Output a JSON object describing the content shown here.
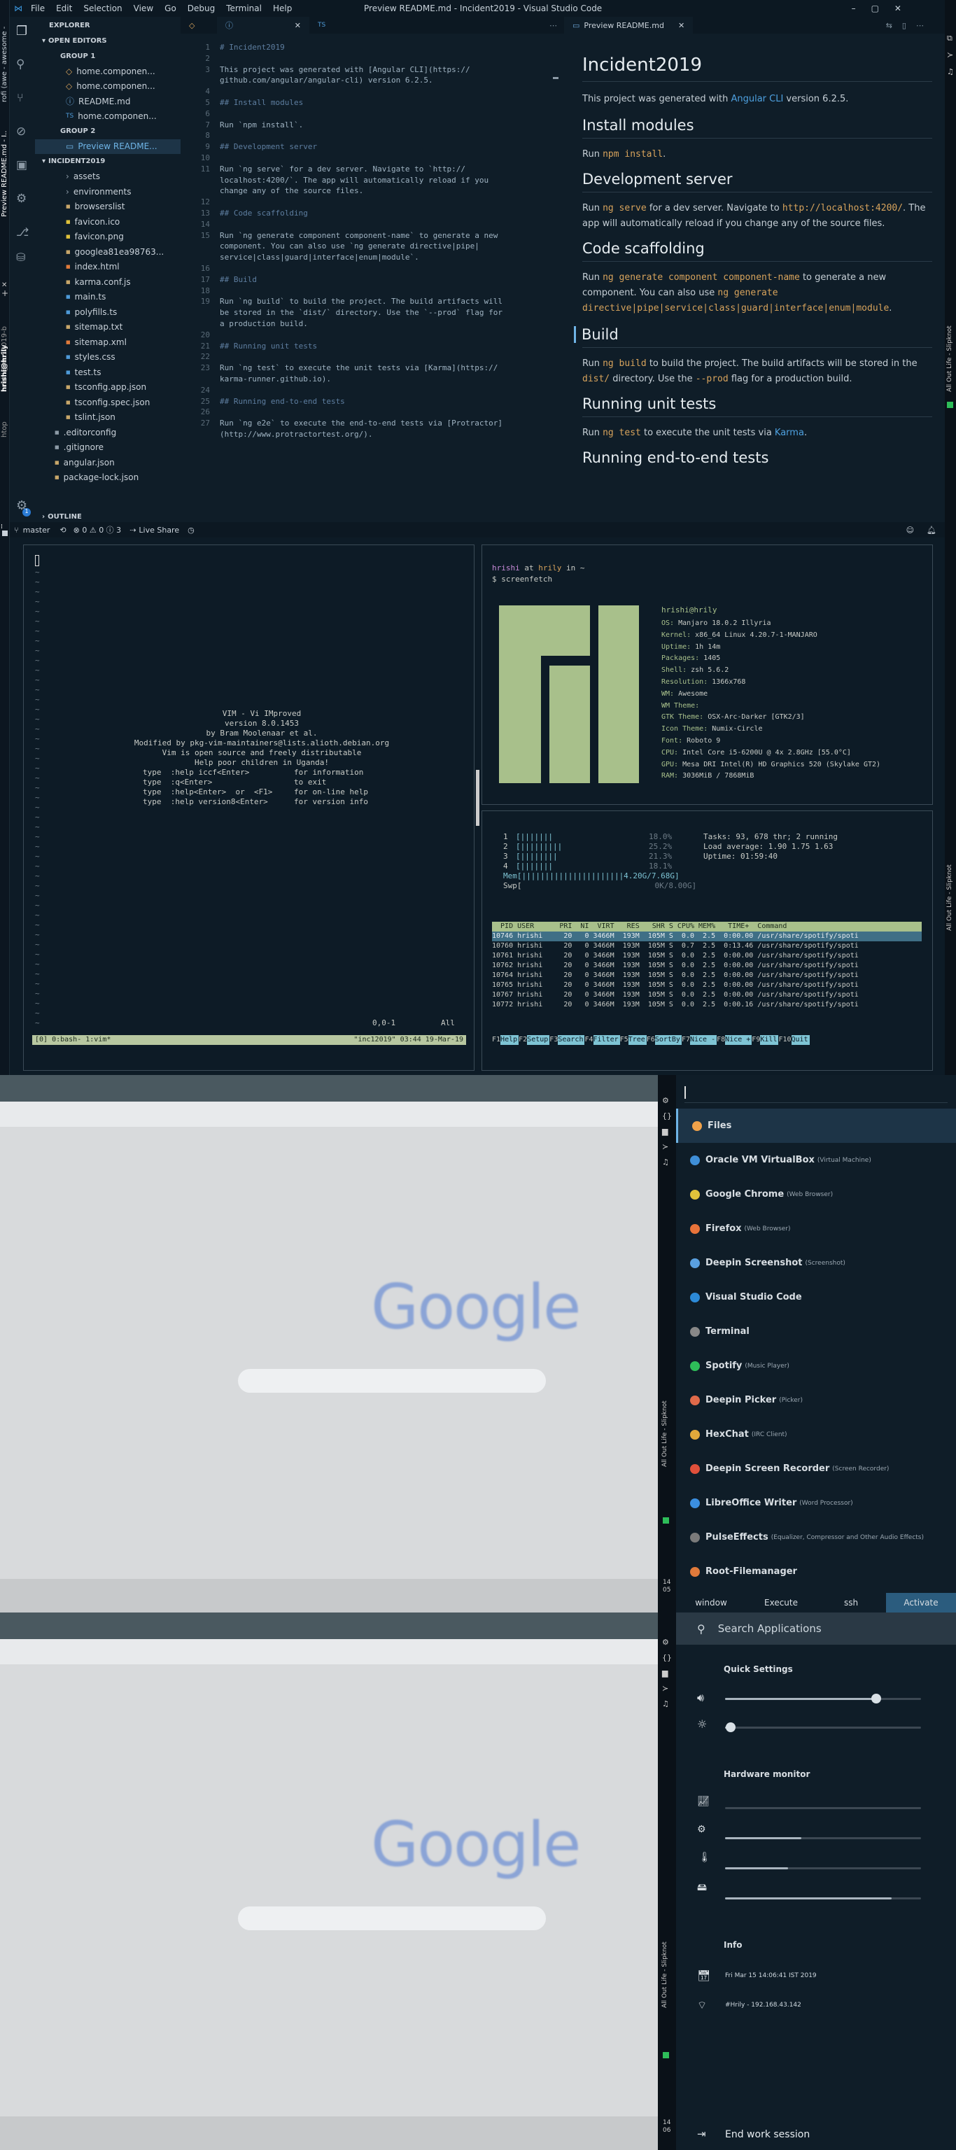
{
  "awesome_bar": {
    "items": [
      "Preview README.md - I..",
      "rofi (awe - awesome -"
    ]
  },
  "vscode": {
    "title": "Preview README.md - Incident2019 - Visual Studio Code",
    "menu": [
      "File",
      "Edit",
      "Selection",
      "View",
      "Go",
      "Debug",
      "Terminal",
      "Help"
    ],
    "explorer_title": "EXPLORER",
    "open_editors": "OPEN EDITORS",
    "group1": "GROUP 1",
    "group1_files": [
      "home.componen...",
      "home.componen...",
      "README.md",
      "home.componen..."
    ],
    "group2": "GROUP 2",
    "group2_files": [
      "Preview README..."
    ],
    "project": "INCIDENT2019",
    "tree": [
      "assets",
      "environments",
      "browserslist",
      "favicon.ico",
      "favicon.png",
      "googlea81ea98763...",
      "index.html",
      "karma.conf.js",
      "main.ts",
      "polyfills.ts",
      "sitemap.txt",
      "sitemap.xml",
      "styles.css",
      "test.ts",
      "tsconfig.app.json",
      "tsconfig.spec.json",
      "tslint.json",
      ".editorconfig",
      ".gitignore",
      "angular.json",
      "package-lock.json"
    ],
    "outline": "OUTLINE",
    "tabs": [
      "",
      "TS"
    ],
    "code": [
      {
        "n": "1",
        "t": "# Incident2019"
      },
      {
        "n": "2",
        "t": ""
      },
      {
        "n": "3",
        "t": "This project was generated with [Angular CLI](https://"
      },
      {
        "n": "",
        "t": "github.com/angular/angular-cli) version 6.2.5."
      },
      {
        "n": "4",
        "t": ""
      },
      {
        "n": "5",
        "t": "## Install modules"
      },
      {
        "n": "6",
        "t": ""
      },
      {
        "n": "7",
        "t": "Run `npm install`."
      },
      {
        "n": "8",
        "t": ""
      },
      {
        "n": "9",
        "t": "## Development server"
      },
      {
        "n": "10",
        "t": ""
      },
      {
        "n": "11",
        "t": "Run `ng serve` for a dev server. Navigate to `http://"
      },
      {
        "n": "",
        "t": "localhost:4200/`. The app will automatically reload if you"
      },
      {
        "n": "",
        "t": "change any of the source files."
      },
      {
        "n": "12",
        "t": ""
      },
      {
        "n": "13",
        "t": "## Code scaffolding"
      },
      {
        "n": "14",
        "t": ""
      },
      {
        "n": "15",
        "t": "Run `ng generate component component-name` to generate a new"
      },
      {
        "n": "",
        "t": "component. You can also use `ng generate directive|pipe|"
      },
      {
        "n": "",
        "t": "service|class|guard|interface|enum|module`."
      },
      {
        "n": "16",
        "t": ""
      },
      {
        "n": "17",
        "t": "## Build"
      },
      {
        "n": "18",
        "t": ""
      },
      {
        "n": "19",
        "t": "Run `ng build` to build the project. The build artifacts will"
      },
      {
        "n": "",
        "t": "be stored in the `dist/` directory. Use the `--prod` flag for"
      },
      {
        "n": "",
        "t": "a production build."
      },
      {
        "n": "20",
        "t": ""
      },
      {
        "n": "21",
        "t": "## Running unit tests"
      },
      {
        "n": "22",
        "t": ""
      },
      {
        "n": "23",
        "t": "Run `ng test` to execute the unit tests via [Karma](https://"
      },
      {
        "n": "",
        "t": "karma-runner.github.io)."
      },
      {
        "n": "24",
        "t": ""
      },
      {
        "n": "25",
        "t": "## Running end-to-end tests"
      },
      {
        "n": "26",
        "t": ""
      },
      {
        "n": "27",
        "t": "Run `ng e2e` to execute the end-to-end tests via [Protractor]"
      },
      {
        "n": "",
        "t": "(http://www.protractortest.org/)."
      }
    ],
    "preview_tab": "Preview README.md",
    "preview": {
      "h1": "Incident2019",
      "p1a": "This project was generated with ",
      "p1link": "Angular CLI",
      "p1b": " version 6.2.5.",
      "h_install": "Install modules",
      "p_install_a": "Run ",
      "p_install_code": "npm install",
      "p_install_b": ".",
      "h_dev": "Development server",
      "p_dev_a": "Run ",
      "p_dev_code": "ng serve",
      "p_dev_b": " for a dev server. Navigate to ",
      "p_dev_code2": "http://localhost:4200/",
      "p_dev_c": ". The app will automatically reload if you change any of the source files.",
      "h_scaf": "Code scaffolding",
      "p_scaf_a": "Run ",
      "p_scaf_code": "ng generate component component-name",
      "p_scaf_b": " to generate a new component. You can also use ",
      "p_scaf_code2": "ng generate directive|pipe|service|class|guard|interface|enum|module",
      "p_scaf_c": ".",
      "h_build": "Build",
      "p_build_a": "Run ",
      "p_build_code": "ng build",
      "p_build_b": " to build the project. The build artifacts will be stored in the ",
      "p_build_code2": "dist/",
      "p_build_c": " directory. Use the ",
      "p_build_code3": "--prod",
      "p_build_d": " flag for a production build.",
      "h_unit": "Running unit tests",
      "p_unit_a": "Run ",
      "p_unit_code": "ng test",
      "p_unit_b": " to execute the unit tests via ",
      "p_unit_link": "Karma",
      "p_unit_c": ".",
      "h_e2e": "Running end-to-end tests"
    },
    "status": {
      "branch": "master",
      "counts": "⊗ 0 ⚠ 0 ⓘ 3",
      "live": "Live Share"
    }
  },
  "vim": {
    "lines": [
      "VIM - Vi IMproved",
      "",
      "version 8.0.1453",
      "by Bram Moolenaar et al.",
      "Modified by pkg-vim-maintainers@lists.alioth.debian.org",
      "Vim is open source and freely distributable",
      "",
      "Help poor children in Uganda!"
    ],
    "help": [
      {
        "a": "type  :help iccf<Enter>",
        "b": "for information"
      },
      {
        "a": "type  :q<Enter>",
        "b": "to exit"
      },
      {
        "a": "type  :help<Enter>  or  <F1>",
        "b": "for on-line help"
      },
      {
        "a": "type  :help version8<Enter>",
        "b": "for version info"
      }
    ],
    "pos": "0,0-1",
    "all": "All",
    "status_left": "[0] 0:bash- 1:vim*",
    "status_right": "\"inc12019\" 03:44 19-Mar-19"
  },
  "screenfetch": {
    "prompt_user": "hrishi",
    "prompt_at": " at ",
    "prompt_host": "hrily",
    "prompt_in": " in ~",
    "cmd": "$ screenfetch",
    "header": "hrishi@hrily",
    "info": [
      {
        "k": "OS:",
        "v": "Manjaro 18.0.2 Illyria"
      },
      {
        "k": "Kernel:",
        "v": "x86_64 Linux 4.20.7-1-MANJARO"
      },
      {
        "k": "Uptime:",
        "v": "1h 14m"
      },
      {
        "k": "Packages:",
        "v": "1405"
      },
      {
        "k": "Shell:",
        "v": "zsh 5.6.2"
      },
      {
        "k": "Resolution:",
        "v": "1366x768"
      },
      {
        "k": "WM:",
        "v": "Awesome"
      },
      {
        "k": "WM Theme:",
        "v": ""
      },
      {
        "k": "GTK Theme:",
        "v": "OSX-Arc-Darker [GTK2/3]"
      },
      {
        "k": "Icon Theme:",
        "v": "Numix-Circle"
      },
      {
        "k": "Font:",
        "v": "Roboto 9"
      },
      {
        "k": "CPU:",
        "v": "Intel Core i5-6200U @ 4x 2.8GHz [55.0°C]"
      },
      {
        "k": "GPU:",
        "v": "Mesa DRI Intel(R) HD Graphics 520 (Skylake GT2)"
      },
      {
        "k": "RAM:",
        "v": "3036MiB / 7868MiB"
      }
    ]
  },
  "htop": {
    "cpus": [
      {
        "n": "1",
        "bar": "[|||||||",
        "pct": "18.0%"
      },
      {
        "n": "2",
        "bar": "[|||||||||",
        "pct": "25.2%"
      },
      {
        "n": "3",
        "bar": "[||||||||",
        "pct": "21.3%"
      },
      {
        "n": "4",
        "bar": "[|||||||",
        "pct": "18.1%"
      }
    ],
    "mem": "Mem[||||||||||||||||||||||4.20G/7.68G]",
    "swp": "Swp[",
    "swp_val": "0K/8.00G]",
    "tasks": "Tasks: 93, 678 thr; 2 running",
    "load": "Load average: 1.90 1.75 1.63",
    "uptime": "Uptime: 01:59:40",
    "header": "  PID USER      PRI  NI  VIRT   RES   SHR S CPU% MEM%   TIME+  Command",
    "rows": [
      "10746 hrishi     20   0 3466M  193M  105M S  0.0  2.5  0:00.00 /usr/share/spotify/spoti",
      "10760 hrishi     20   0 3466M  193M  105M S  0.7  2.5  0:13.46 /usr/share/spotify/spoti",
      "10761 hrishi     20   0 3466M  193M  105M S  0.0  2.5  0:00.00 /usr/share/spotify/spoti",
      "10762 hrishi     20   0 3466M  193M  105M S  0.0  2.5  0:00.00 /usr/share/spotify/spoti",
      "10764 hrishi     20   0 3466M  193M  105M S  0.0  2.5  0:00.00 /usr/share/spotify/spoti",
      "10765 hrishi     20   0 3466M  193M  105M S  0.0  2.5  0:00.00 /usr/share/spotify/spoti",
      "10767 hrishi     20   0 3466M  193M  105M S  0.0  2.5  0:00.00 /usr/share/spotify/spoti",
      "10772 hrishi     20   0 3466M  193M  105M S  0.0  2.5  0:00.16 /usr/share/spotify/spoti"
    ],
    "fkeys": [
      "Help",
      "Setup",
      "Search",
      "Filter",
      "Tree",
      "SortBy",
      "Nice -",
      "Nice +",
      "Kill",
      "Quit"
    ]
  },
  "side_rail_left": [
    "hrishi@inc12019-b",
    "htop",
    "hrishi@hrily"
  ],
  "side_rail_right": [
    "All Out Life - Slipknot",
    "All Out Life - Slipknot"
  ],
  "rofi": {
    "items": [
      {
        "name": "Files",
        "desc": "",
        "color": "#f0a24a"
      },
      {
        "name": "Oracle VM VirtualBox",
        "desc": "(Virtual Machine)",
        "color": "#3f8fd8"
      },
      {
        "name": "Google Chrome",
        "desc": "(Web Browser)",
        "color": "#e0c23b"
      },
      {
        "name": "Firefox",
        "desc": "(Web Browser)",
        "color": "#e8733a"
      },
      {
        "name": "Deepin Screenshot",
        "desc": "(Screenshot)",
        "color": "#5aa0e0"
      },
      {
        "name": "Visual Studio Code",
        "desc": "",
        "color": "#2c8ad8"
      },
      {
        "name": "Terminal",
        "desc": "",
        "color": "#888"
      },
      {
        "name": "Spotify",
        "desc": "(Music Player)",
        "color": "#2ebd59"
      },
      {
        "name": "Deepin Picker",
        "desc": "(Picker)",
        "color": "#e06a4a"
      },
      {
        "name": "HexChat",
        "desc": "(IRC Client)",
        "color": "#e0a83b"
      },
      {
        "name": "Deepin Screen Recorder",
        "desc": "(Screen Recorder)",
        "color": "#e0503b"
      },
      {
        "name": "LibreOffice Writer",
        "desc": "(Word Processor)",
        "color": "#3b8fe0"
      },
      {
        "name": "PulseEffects",
        "desc": "(Equalizer, Compressor and Other Audio Effects)",
        "color": "#7a7a7a"
      },
      {
        "name": "Root-Filemanager",
        "desc": "",
        "color": "#e07a3b"
      }
    ],
    "modes": [
      "window",
      "Execute",
      "ssh",
      "Activate"
    ],
    "clock": {
      "h": "14",
      "m": "05"
    }
  },
  "google_bg": {
    "logo": "Google"
  },
  "quick": {
    "search_placeholder": "Search Applications",
    "quick_title": "Quick Settings",
    "volume": 0.77,
    "brightness": 0.03,
    "hw_title": "Hardware monitor",
    "hw": [
      0.0,
      0.39,
      0.32,
      0.85
    ],
    "info_title": "Info",
    "date": "Fri Mar 15 14:06:41 IST 2019",
    "wifi": "#Hrily - 192.168.43.142",
    "end": "End work session",
    "clock": {
      "h": "14",
      "m": "06"
    }
  }
}
